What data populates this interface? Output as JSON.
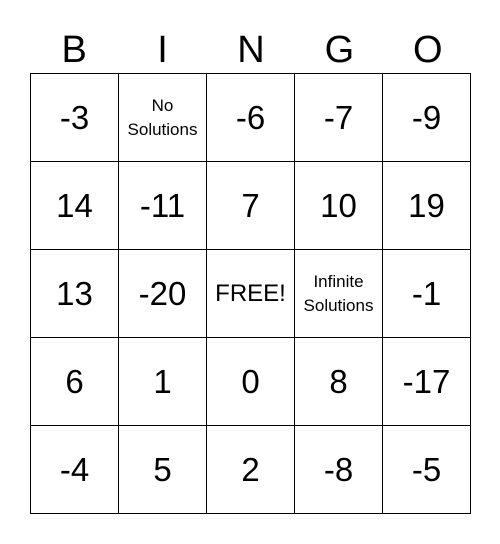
{
  "header": [
    "B",
    "I",
    "N",
    "G",
    "O"
  ],
  "rows": [
    [
      "-3",
      "No Solutions",
      "-6",
      "-7",
      "-9"
    ],
    [
      "14",
      "-11",
      "7",
      "10",
      "19"
    ],
    [
      "13",
      "-20",
      "FREE!",
      "Infinite Solutions",
      "-1"
    ],
    [
      "6",
      "1",
      "0",
      "8",
      "-17"
    ],
    [
      "-4",
      "5",
      "2",
      "-8",
      "-5"
    ]
  ]
}
